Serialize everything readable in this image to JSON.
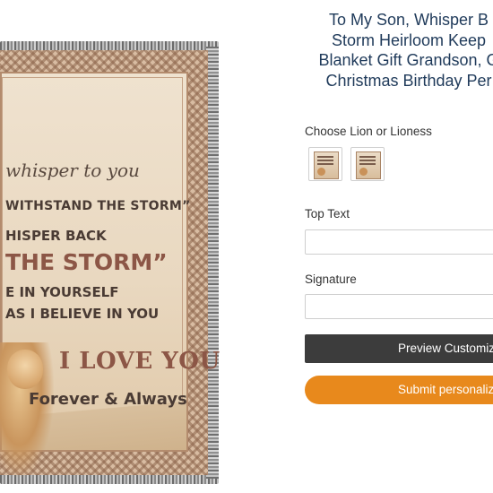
{
  "product": {
    "title_lines": [
      "To My Son, Whisper B",
      "Storm Heirloom Keep",
      "Blanket Gift Grandson, G",
      "Christmas Birthday Per"
    ]
  },
  "blanket_image": {
    "lines": [
      "whisper to you",
      "WITHSTAND THE STORM”",
      "HISPER BACK",
      "THE STORM”",
      "E IN YOURSELF",
      "AS I BELIEVE IN YOU",
      "I LOVE YOU",
      "Forever & Always"
    ]
  },
  "options": {
    "choose_label": "Choose Lion or Lioness",
    "swatches": [
      {
        "icon": "lion-blanket-thumbnail"
      },
      {
        "icon": "lioness-blanket-thumbnail"
      }
    ]
  },
  "fields": {
    "top_text_label": "Top Text",
    "top_text_value": "",
    "signature_label": "Signature",
    "signature_value": ""
  },
  "buttons": {
    "preview_label": "Preview Customiz",
    "submit_label": "Submit personaliz"
  },
  "colors": {
    "title": "#1f3a5a",
    "preview_button": "#3c3c3c",
    "submit_button": "#e8891c"
  }
}
